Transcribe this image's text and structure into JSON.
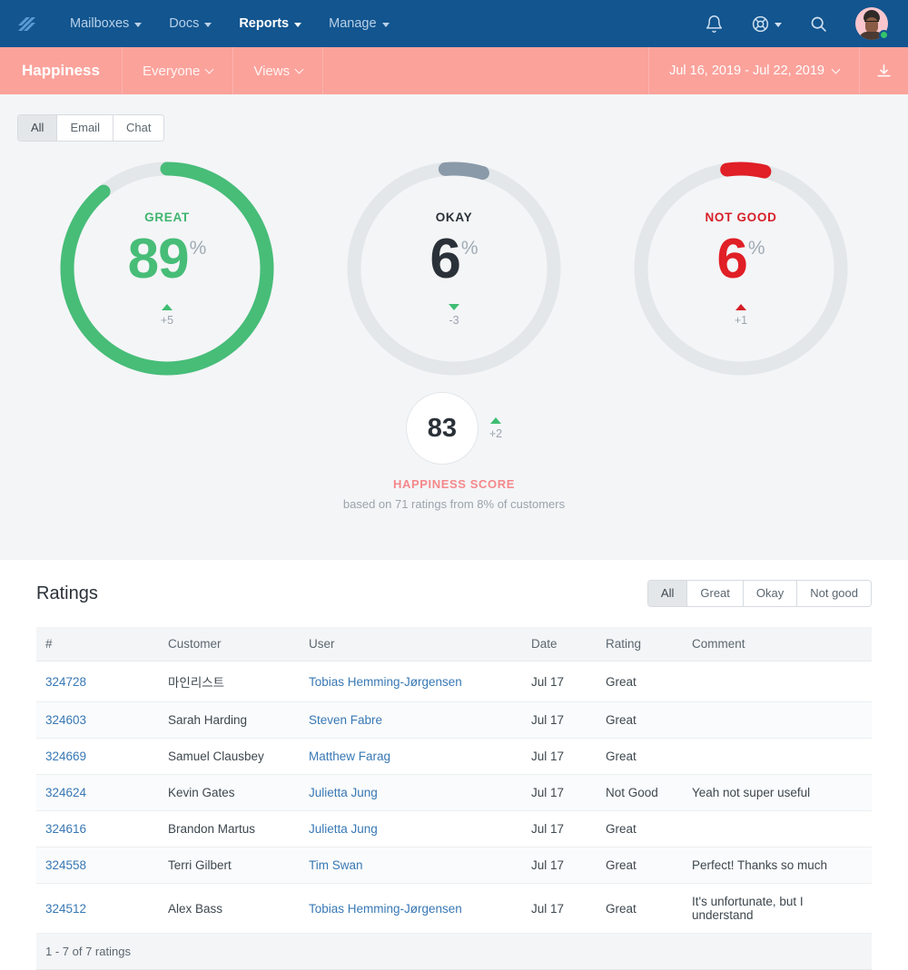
{
  "topnav": {
    "logo_name": "helpscout-logo",
    "items": [
      {
        "label": "Mailboxes",
        "active": false
      },
      {
        "label": "Docs",
        "active": false
      },
      {
        "label": "Reports",
        "active": true
      },
      {
        "label": "Manage",
        "active": false
      }
    ],
    "icons": {
      "bell": "bell-icon",
      "lifebuoy": "lifebuoy-icon",
      "search": "search-icon",
      "avatar": "user-avatar"
    }
  },
  "subnav": {
    "title": "Happiness",
    "scope": "Everyone",
    "views": "Views",
    "date_range": "Jul 16, 2019 - Jul 22, 2019",
    "download_label": "download-icon"
  },
  "channel_filter": {
    "options": [
      "All",
      "Email",
      "Chat"
    ],
    "selected": "All"
  },
  "chart_data": {
    "type": "pie",
    "title": "Happiness",
    "legend_position": "center",
    "donuts": [
      {
        "label": "GREAT",
        "value": 89,
        "unit": "%",
        "delta": "+5",
        "delta_direction": "up",
        "color": "#47bd78",
        "track": "#e3e7ea"
      },
      {
        "label": "OKAY",
        "value": 6,
        "unit": "%",
        "delta": "-3",
        "delta_direction": "down",
        "color": "#8a9aa9",
        "track": "#e3e7ea"
      },
      {
        "label": "NOT GOOD",
        "value": 6,
        "unit": "%",
        "delta": "+1",
        "delta_direction": "up",
        "color": "#e01f26",
        "track": "#e3e7ea"
      }
    ],
    "score": {
      "value": "83",
      "delta": "+2",
      "delta_direction": "up",
      "title": "HAPPINESS SCORE",
      "subtitle": "based on 71 ratings from 8% of customers",
      "title_color": "#f4888b"
    }
  },
  "ratings": {
    "heading": "Ratings",
    "filters": {
      "options": [
        "All",
        "Great",
        "Okay",
        "Not good"
      ],
      "selected": "All"
    },
    "columns": [
      "#",
      "Customer",
      "User",
      "Date",
      "Rating",
      "Comment"
    ],
    "rows": [
      {
        "id": "324728",
        "customer": "마인리스트",
        "user": "Tobias Hemming-Jørgensen",
        "date": "Jul 17",
        "rating": "Great",
        "comment": ""
      },
      {
        "id": "324603",
        "customer": "Sarah Harding",
        "user": "Steven Fabre",
        "date": "Jul 17",
        "rating": "Great",
        "comment": ""
      },
      {
        "id": "324669",
        "customer": "Samuel Clausbey",
        "user": "Matthew Farag",
        "date": "Jul 17",
        "rating": "Great",
        "comment": ""
      },
      {
        "id": "324624",
        "customer": "Kevin Gates",
        "user": "Julietta Jung",
        "date": "Jul 17",
        "rating": "Not Good",
        "comment": "Yeah not super useful"
      },
      {
        "id": "324616",
        "customer": "Brandon Martus",
        "user": "Julietta Jung",
        "date": "Jul 17",
        "rating": "Great",
        "comment": ""
      },
      {
        "id": "324558",
        "customer": "Terri Gilbert",
        "user": "Tim Swan",
        "date": "Jul 17",
        "rating": "Great",
        "comment": "Perfect! Thanks so much"
      },
      {
        "id": "324512",
        "customer": "Alex Bass",
        "user": "Tobias Hemming-Jørgensen",
        "date": "Jul 17",
        "rating": "Great",
        "comment": "It's unfortunate, but I understand"
      }
    ],
    "footer": "1 - 7 of 7 ratings"
  },
  "colors": {
    "nav_blue": "#12558f",
    "subnav_pink": "#fba29b",
    "green": "#47bd78",
    "grey_blue": "#8a9aa9",
    "red": "#e01f26",
    "link": "#3878b4"
  }
}
